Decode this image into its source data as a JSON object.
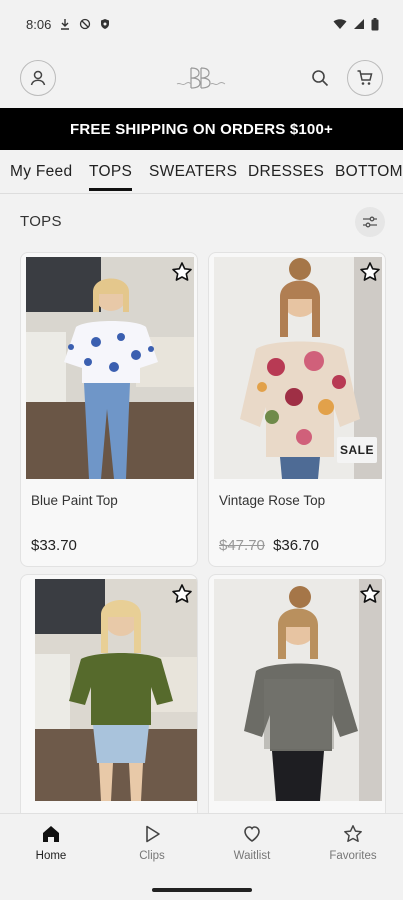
{
  "status_bar": {
    "time": "8:06"
  },
  "logo_alt": "Bonita Bliss",
  "banner": {
    "text": "FREE SHIPPING ON ORDERS $100+"
  },
  "tabs": [
    {
      "label": "My Feed"
    },
    {
      "label": "TOPS"
    },
    {
      "label": "SWEATERS"
    },
    {
      "label": "DRESSES"
    },
    {
      "label": "BOTTOMS"
    }
  ],
  "active_tab": "TOPS",
  "section": {
    "title": "TOPS"
  },
  "products": [
    {
      "name": "Blue Paint Top",
      "price": "$33.70",
      "old_price": "",
      "sale": false
    },
    {
      "name": "Vintage Rose Top",
      "price": "$36.70",
      "old_price": "$47.70",
      "sale": true,
      "sale_label": "SALE"
    },
    {
      "name": "",
      "price": "",
      "old_price": "",
      "sale": false
    },
    {
      "name": "",
      "price": "",
      "old_price": "",
      "sale": false
    }
  ],
  "bottom_nav": [
    {
      "label": "Home",
      "icon": "home-icon",
      "active": true
    },
    {
      "label": "Clips",
      "icon": "play-icon",
      "active": false
    },
    {
      "label": "Waitlist",
      "icon": "heart-icon",
      "active": false
    },
    {
      "label": "Favorites",
      "icon": "star-icon",
      "active": false
    }
  ],
  "colors": {
    "banner_bg": "#000000",
    "background": "#f2f2f2",
    "text": "#222222",
    "muted": "#777777"
  }
}
